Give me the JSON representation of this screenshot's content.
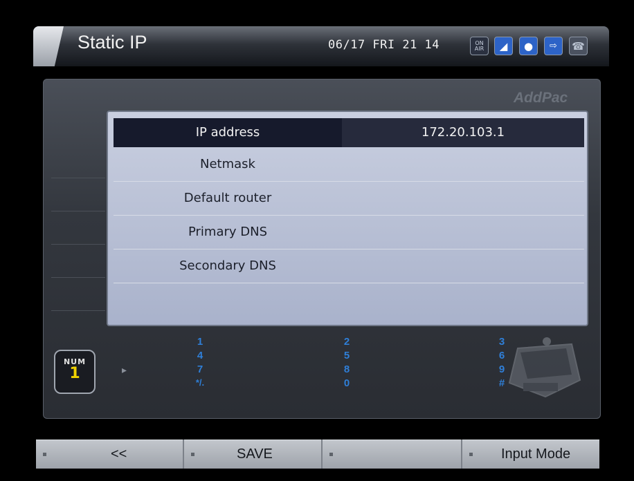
{
  "header": {
    "title": "Static IP",
    "datetime": "06/17 FRI 21 14",
    "icons": [
      "on-air-icon",
      "speaker-icon",
      "user-icon",
      "network-icon",
      "phone-icon"
    ],
    "on_air_text": "ON\nAIR"
  },
  "brand": "AddPac",
  "settings": {
    "rows": [
      {
        "label": "IP address",
        "value": "172.20.103.1"
      },
      {
        "label": "Netmask",
        "value": ""
      },
      {
        "label": "Default router",
        "value": ""
      },
      {
        "label": "Primary DNS",
        "value": ""
      },
      {
        "label": "Secondary DNS",
        "value": ""
      }
    ],
    "selected_row": 0
  },
  "input_mode": {
    "badge_text": "NUM",
    "badge_number": "1"
  },
  "keypad": {
    "col1": [
      "1",
      "4",
      "7",
      "*/."
    ],
    "col2": [
      "2",
      "5",
      "8",
      "0"
    ],
    "col3": [
      "3",
      "6",
      "9",
      "#"
    ]
  },
  "bottom_bar": {
    "back": "<<",
    "save": "SAVE",
    "blank": "",
    "input_mode": "Input Mode"
  },
  "colors": {
    "accent_blue": "#2d63c7",
    "key_blue": "#2f7fd8",
    "selected_row": "#161a2c",
    "badge_yellow": "#f0d200"
  }
}
